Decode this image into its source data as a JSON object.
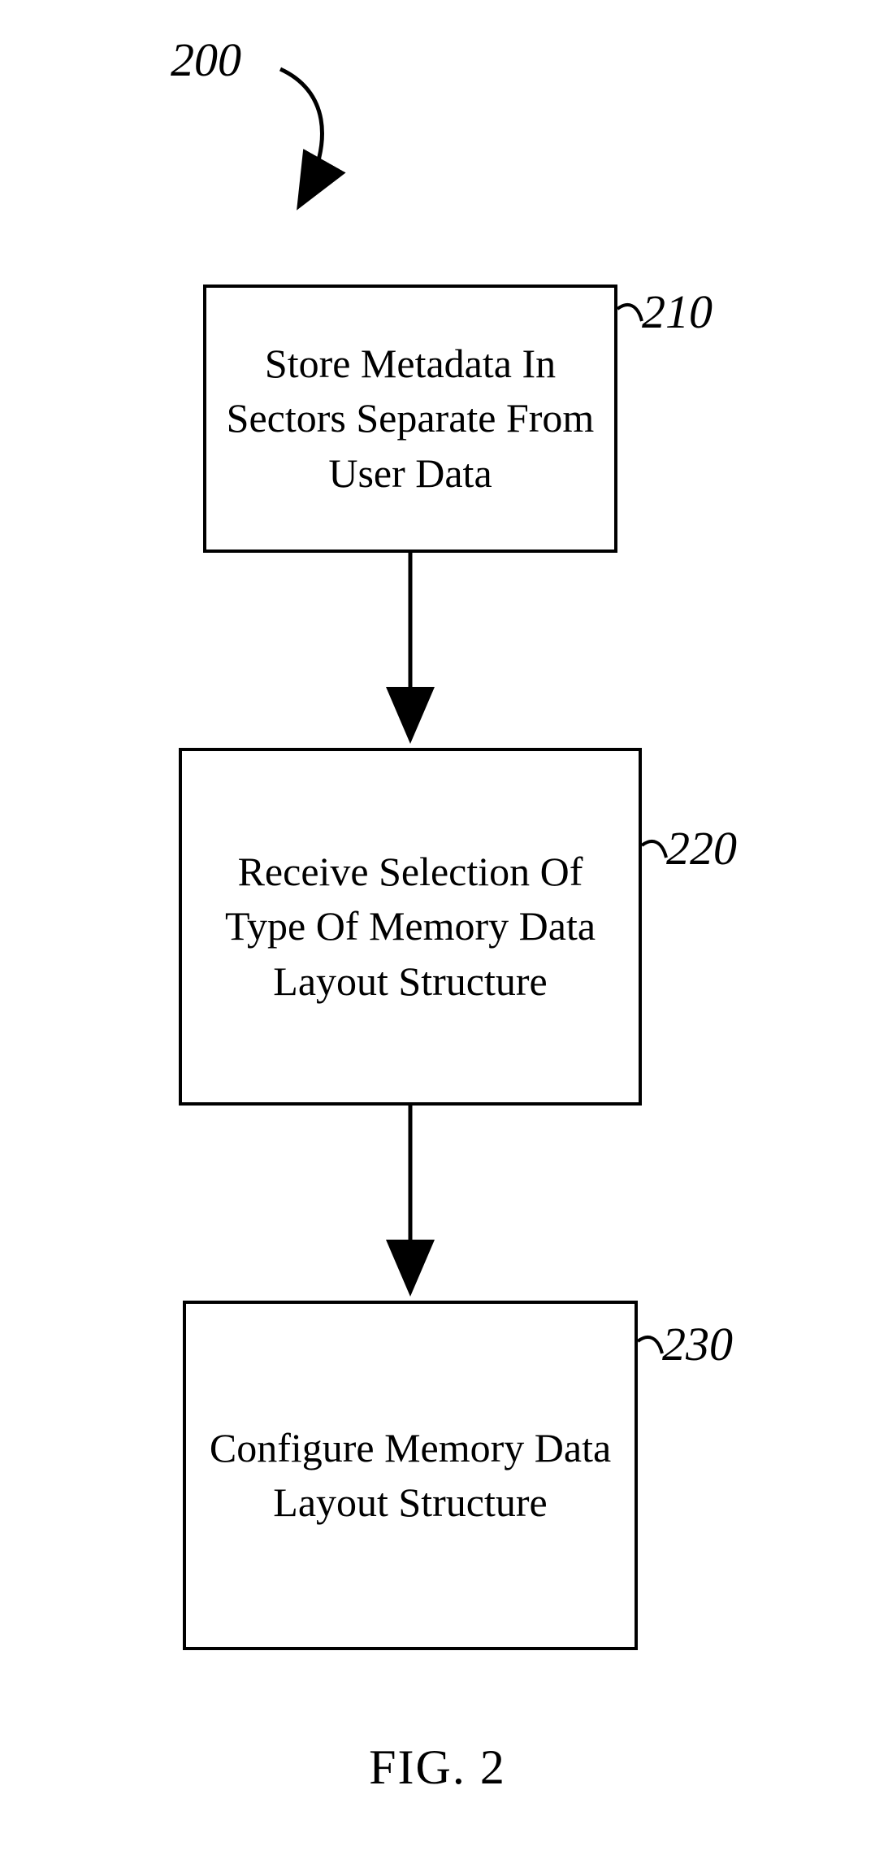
{
  "figure": {
    "number_label": "200",
    "caption": "FIG. 2"
  },
  "steps": [
    {
      "ref": "210",
      "text": "Store Metadata In Sectors Separate From User Data"
    },
    {
      "ref": "220",
      "text": "Receive Selection Of Type Of Memory Data Layout Structure"
    },
    {
      "ref": "230",
      "text": "Configure Memory Data Layout Structure"
    }
  ]
}
